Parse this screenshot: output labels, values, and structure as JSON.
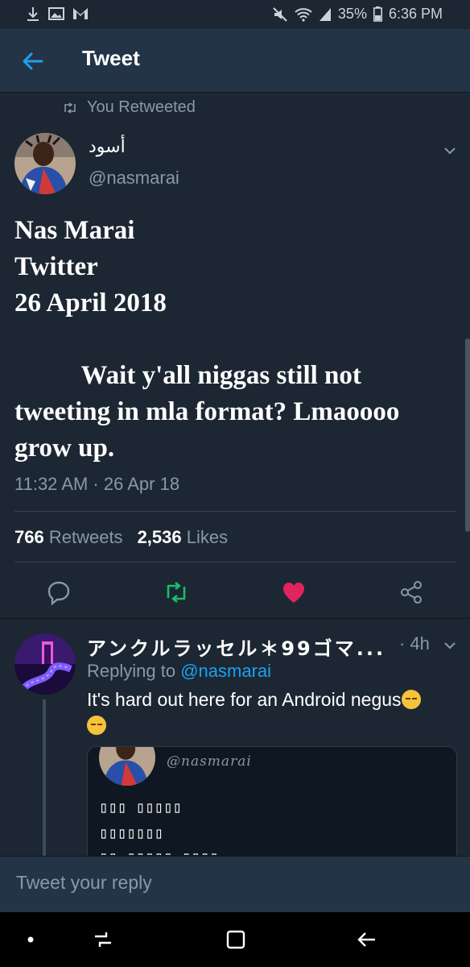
{
  "status_bar": {
    "left_icons": [
      "download-icon",
      "image-icon",
      "gmail-icon"
    ],
    "battery": "35%",
    "time": "6:36 PM",
    "right_icons": [
      "mute-icon",
      "wifi-icon",
      "signal-icon",
      "battery-icon"
    ]
  },
  "header": {
    "title": "Tweet",
    "back_icon": "arrow-left-icon"
  },
  "tweet": {
    "retweet_note": "You Retweeted",
    "display_name": "أسود",
    "handle": "@nasmarai",
    "text": "Nas Marai\nTwitter\n26 April 2018\n\n          Wait y'all niggas still not tweeting in mla format? Lmaoooo grow up.",
    "timestamp": "11:32 AM · 26 Apr 18",
    "retweets_count": "766",
    "retweets_label": "Retweets",
    "likes_count": "2,536",
    "likes_label": "Likes",
    "actions": [
      "reply-icon",
      "retweet-icon",
      "heart-icon",
      "share-icon"
    ],
    "colors": {
      "retweet_active": "#17bf63",
      "like_active": "#e0245e",
      "accent": "#1da1f2"
    }
  },
  "reply": {
    "display_name": "アンクルラッセル＊99ゴマ...",
    "time": "· 4h",
    "replying_label": "Replying to",
    "replying_mention": "@nasmarai",
    "text": "It's hard out here for an Android negus",
    "embed": {
      "handle": "@nasmarai",
      "line1": "▯▯▯ ▯▯▯▯▯",
      "line2": "▯▯▯▯▯▯▯",
      "line3": "▯▯ ▯▯▯▯▯ ▯▯▯▯"
    }
  },
  "compose": {
    "placeholder": "Tweet your reply"
  },
  "nav_bar": [
    "recent-dot-icon",
    "recents-icon",
    "home-icon",
    "back-icon"
  ]
}
